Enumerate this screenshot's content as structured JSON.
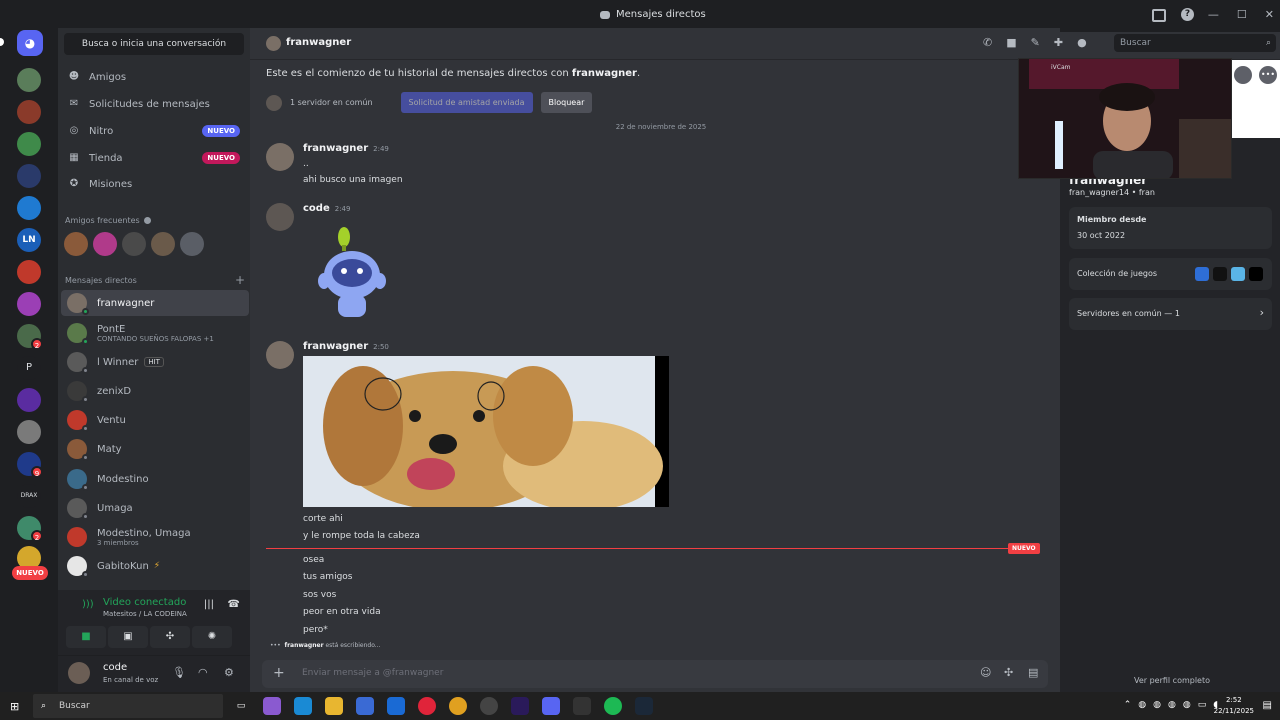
{
  "window": {
    "title": "Mensajes directos",
    "controls": [
      "—",
      "☐",
      "✕"
    ]
  },
  "sidebar": {
    "search_label": "Busca o inicia una conversación",
    "nav": [
      {
        "label": "Amigos",
        "icon": "friends-icon",
        "tag": ""
      },
      {
        "label": "Solicitudes de mensajes",
        "icon": "mail-icon",
        "tag": ""
      },
      {
        "label": "Nitro",
        "icon": "nitro-icon",
        "tag": "NUEVO"
      },
      {
        "label": "Tienda",
        "icon": "shop-icon",
        "tag": "NUEVO"
      },
      {
        "label": "Misiones",
        "icon": "compass-icon",
        "tag": ""
      }
    ],
    "frequent_header": "Amigos frecuentes",
    "dm_header": "Mensajes directos",
    "dms": [
      {
        "name": "franwagner",
        "sub": ""
      },
      {
        "name": "PontE",
        "sub": "CONTANDO SUEÑOS FALOPAS +1"
      },
      {
        "name": "l Winner",
        "sub": "",
        "tag": "HIT"
      },
      {
        "name": "zenixD",
        "sub": ""
      },
      {
        "name": "Ventu",
        "sub": ""
      },
      {
        "name": "Maty",
        "sub": ""
      },
      {
        "name": "Modestino",
        "sub": ""
      },
      {
        "name": "Umaga",
        "sub": ""
      },
      {
        "name": "Modestino, Umaga",
        "sub": "3 miembros"
      },
      {
        "name": "GabitoKun",
        "sub": ""
      }
    ],
    "voice": {
      "status": "Video conectado",
      "channel": "Matesitos / LA CODEINA"
    },
    "user": {
      "name": "code",
      "status": "En canal de voz"
    }
  },
  "rail": {
    "nuevo_label": "NUEVO",
    "badges": [
      "2",
      "9",
      "2",
      "2"
    ],
    "letters": [
      "P",
      "DRAX"
    ]
  },
  "chat": {
    "recipient": "franwagner",
    "intro_prefix": "Este es el comienzo de tu historial de mensajes directos con ",
    "intro_name": "franwagner",
    "intro_suffix": ".",
    "mutual": "1 servidor en común",
    "request_sent": "Solicitud de amistad enviada",
    "block": "Bloquear",
    "date_divider": "22 de noviembre de 2025",
    "search_placeholder": "Buscar",
    "messages": [
      {
        "author": "franwagner",
        "time": "2:49",
        "lines": [
          "..",
          "ahi busco una imagen"
        ]
      },
      {
        "author": "code",
        "time": "2:49",
        "lines": []
      },
      {
        "author": "franwagner",
        "time": "2:50",
        "lines": [
          "corte ahi",
          "y le rompe toda la cabeza"
        ]
      }
    ],
    "after_new": [
      "osea",
      "tus amigos",
      "sos vos",
      "peor en otra vida",
      "pero*"
    ],
    "new_label": "NUEVO",
    "typing_name": "franwagner",
    "typing_text": " está escribiendo...",
    "composer_placeholder": "Enviar mensaje a @franwagner"
  },
  "profile": {
    "cam_label": "iVCam",
    "display_name": "franwagner",
    "handle": "fran_wagner14 • fran",
    "member_since_label": "Miembro desde",
    "member_since": "30 oct 2022",
    "games_label": "Colección de juegos",
    "mutual_servers": "Servidores en común — 1",
    "view_full": "Ver perfil completo"
  },
  "taskbar": {
    "search": "Buscar",
    "time": "2:52",
    "date": "22/11/2025"
  },
  "colors": {
    "blurple": "#5865f2",
    "green": "#23a55a",
    "red": "#f23f43"
  }
}
